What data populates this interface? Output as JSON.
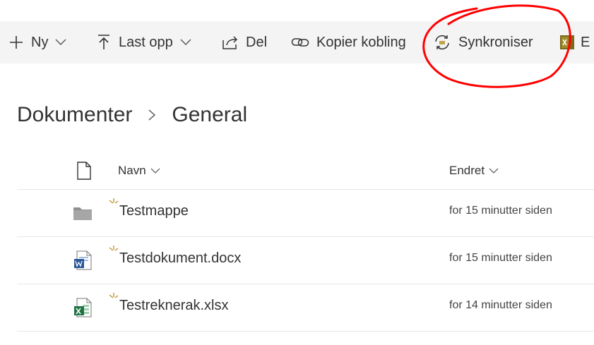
{
  "commandbar": {
    "new_label": "Ny",
    "upload_label": "Last opp",
    "share_label": "Del",
    "copy_link_label": "Kopier kobling",
    "sync_label": "Synkroniser",
    "excel_label": "E"
  },
  "breadcrumb": {
    "root": "Dokumenter",
    "current": "General"
  },
  "list": {
    "headers": {
      "name": "Navn",
      "modified": "Endret"
    },
    "rows": [
      {
        "type": "folder-icon",
        "name": "Testmappe",
        "modified": "for 15 minutter siden"
      },
      {
        "type": "word-icon",
        "name": "Testdokument.docx",
        "modified": "for 15 minutter siden"
      },
      {
        "type": "excel-icon",
        "name": "Testreknerak.xlsx",
        "modified": "for 14 minutter siden"
      }
    ]
  },
  "colors": {
    "commandbar_bg": "#f4f4f4",
    "text": "#333333",
    "new_badge": "#c4a44a",
    "word_blue": "#2b579a",
    "excel_green": "#217346",
    "annotation_red": "#ff0000"
  }
}
